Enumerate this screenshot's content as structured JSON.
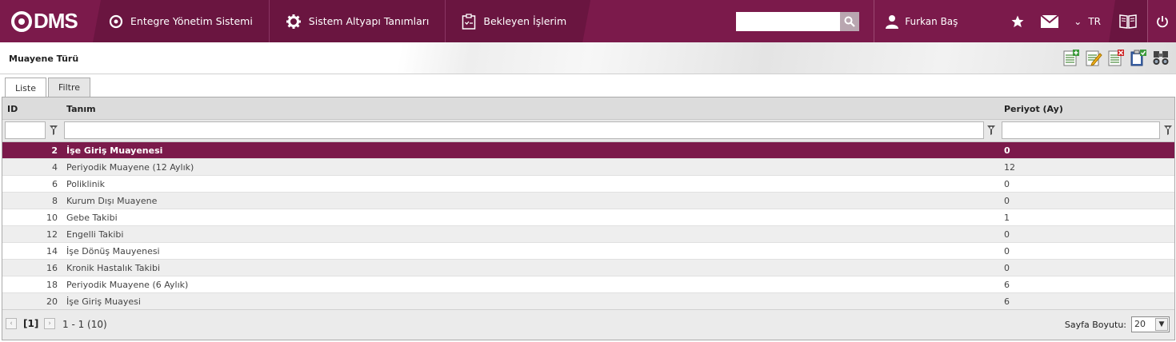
{
  "app": {
    "logo_text": "DMS",
    "brand_color": "#7b1a4b",
    "nav": [
      {
        "label": "Entegre Yönetim Sistemi",
        "icon": "logo-circle-icon"
      },
      {
        "label": "Sistem Altyapı Tanımları",
        "icon": "gear-icon"
      },
      {
        "label": "Bekleyen İşlerim",
        "icon": "clipboard-icon"
      }
    ],
    "search_placeholder": "",
    "user_name": "Furkan Baş",
    "language": "TR"
  },
  "page": {
    "title": "Muayene Türü",
    "tabs": [
      {
        "label": "Liste",
        "active": true
      },
      {
        "label": "Filtre",
        "active": false
      }
    ]
  },
  "grid": {
    "columns": {
      "id": "ID",
      "tanim": "Tanım",
      "periyot": "Periyot (Ay)"
    },
    "rows": [
      {
        "id": "2",
        "tanim": "İşe Giriş Muayenesi",
        "periyot": "0",
        "selected": true
      },
      {
        "id": "4",
        "tanim": "Periyodik Muayene (12 Aylık)",
        "periyot": "12"
      },
      {
        "id": "6",
        "tanim": "Poliklinik",
        "periyot": "0"
      },
      {
        "id": "8",
        "tanim": "Kurum Dışı Muayene",
        "periyot": "0"
      },
      {
        "id": "10",
        "tanim": "Gebe Takibi",
        "periyot": "1"
      },
      {
        "id": "12",
        "tanim": "Engelli Takibi",
        "periyot": "0"
      },
      {
        "id": "14",
        "tanim": "İşe Dönüş Mauyenesi",
        "periyot": "0"
      },
      {
        "id": "16",
        "tanim": "Kronik Hastalık Takibi",
        "periyot": "0"
      },
      {
        "id": "18",
        "tanim": "Periyodik Muayene (6 Aylık)",
        "periyot": "6"
      },
      {
        "id": "20",
        "tanim": "İşe Giriş Muayesi",
        "periyot": "6"
      }
    ]
  },
  "pager": {
    "current_page": "[1]",
    "info": "1 - 1 (10)",
    "page_size_label": "Sayfa Boyutu:",
    "page_size": "20"
  }
}
